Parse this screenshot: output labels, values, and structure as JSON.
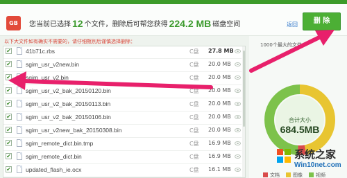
{
  "header": {
    "icon_text": "GB",
    "summary_prefix": "您当前已选择",
    "file_count": "12",
    "summary_mid": "个文件，删除后可帮您获得",
    "space_value": "224.2 MB",
    "summary_suffix": "磁盘空间",
    "return_link": "返回",
    "delete_button": "删 除"
  },
  "hint": "以下大文件如有确实不需要的，请仔细甄别后谨慎选择删除：",
  "files": [
    {
      "name": "41b71c.rbs",
      "drive": "C盘",
      "size": "27.8 MB",
      "checked": true
    },
    {
      "name": "sgim_usr_v2new.bin",
      "drive": "C盘",
      "size": "20.0 MB",
      "checked": true
    },
    {
      "name": "sgim_usr_v2.bin",
      "drive": "C盘",
      "size": "20.0 MB",
      "checked": true
    },
    {
      "name": "sgim_usr_v2_bak_20150120.bin",
      "drive": "C盘",
      "size": "20.0 MB",
      "checked": true
    },
    {
      "name": "sgim_usr_v2_bak_20150113.bin",
      "drive": "C盘",
      "size": "20.0 MB",
      "checked": true
    },
    {
      "name": "sgim_usr_v2_bak_20150106.bin",
      "drive": "C盘",
      "size": "20.0 MB",
      "checked": true
    },
    {
      "name": "sgim_usr_v2new_bak_20150308.bin",
      "drive": "C盘",
      "size": "20.0 MB",
      "checked": true
    },
    {
      "name": "sgim_remote_dict.bin.tmp",
      "drive": "C盘",
      "size": "16.9 MB",
      "checked": true
    },
    {
      "name": "sgim_remote_dict.bin",
      "drive": "C盘",
      "size": "16.9 MB",
      "checked": true
    },
    {
      "name": "updated_flash_ie.ocx",
      "drive": "C盘",
      "size": "16.1 MB",
      "checked": true
    }
  ],
  "panel": {
    "title": "1000个最大的文件",
    "total_label": "合计大小",
    "total_value": "684.5MB",
    "legend": [
      {
        "label": "文档",
        "color": "#d94b4b"
      },
      {
        "label": "图像",
        "color": "#e8c531"
      },
      {
        "label": "视频",
        "color": "#7dc24b"
      }
    ],
    "ring_segments": [
      {
        "fraction": 0.47,
        "color": "#e8c531"
      },
      {
        "fraction": 0.04,
        "color": "#d94b4b"
      },
      {
        "fraction": 0.49,
        "color": "#7dc24b"
      }
    ]
  },
  "watermark": {
    "title": "系统之家",
    "url": "Win10net.com"
  }
}
